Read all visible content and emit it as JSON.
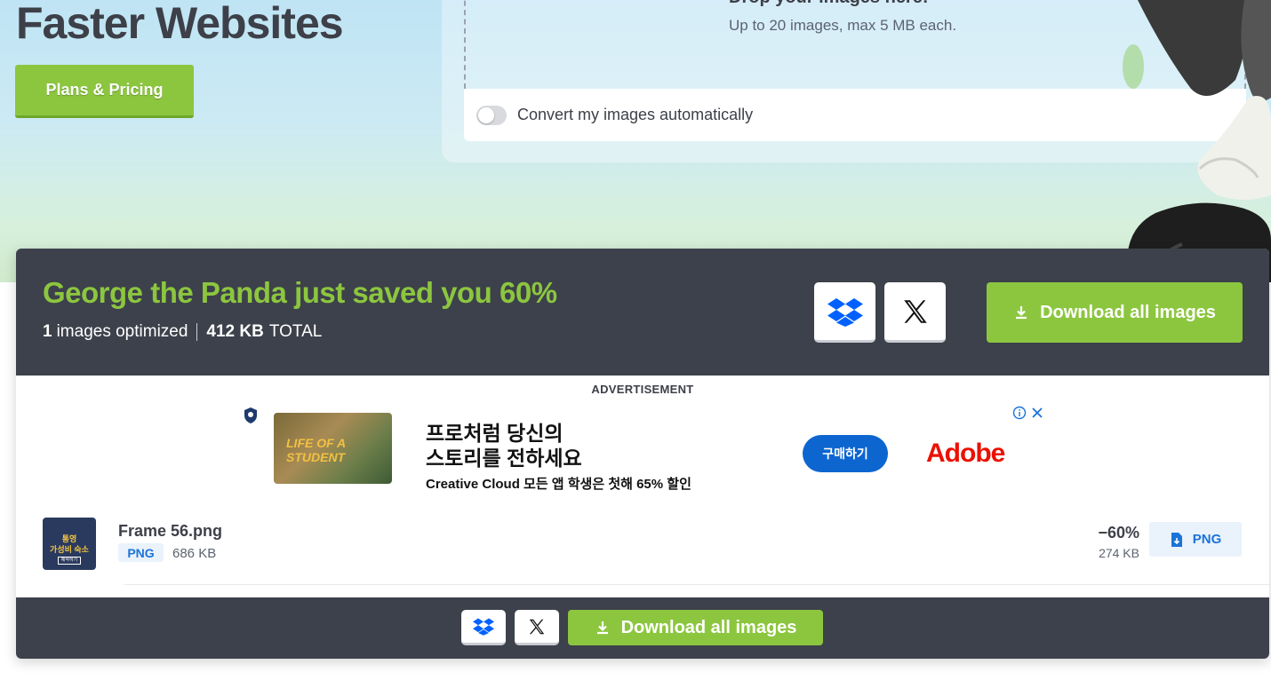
{
  "hero": {
    "title": "Faster Websites",
    "plans_button": "Plans & Pricing",
    "drop_title": "Drop your images here!",
    "drop_subtitle": "Up to 20 images, max 5 MB each.",
    "convert_label": "Convert my images automatically",
    "convert_toggle_on": false
  },
  "summary": {
    "headline": "George the Panda just saved you 60%",
    "images_count": "1",
    "images_label": "images optimized",
    "total_size": "412 KB",
    "total_label": "TOTAL",
    "download_all": "Download all images"
  },
  "ad": {
    "label": "ADVERTISEMENT",
    "thumb_text": "LIFE OF A STUDENT",
    "headline_line1": "프로처럼 당신의",
    "headline_line2": "스토리를 전하세요",
    "subline": "Creative Cloud 모든 앱 학생은 첫해 65% 할인",
    "cta": "구매하기",
    "brand": "Adobe"
  },
  "files": [
    {
      "name": "Frame 56.png",
      "type": "PNG",
      "original_size": "686 KB",
      "saving": "−60%",
      "new_size": "274 KB",
      "download_label": "PNG",
      "thumb_line1": "통영",
      "thumb_line2": "가성비 숙소",
      "thumb_line3": "예약하기"
    }
  ],
  "footer": {
    "download_all": "Download all images"
  },
  "colors": {
    "accent_green": "#8cc63f",
    "panel_dark": "#3d414b",
    "link_blue": "#1a73d9"
  }
}
